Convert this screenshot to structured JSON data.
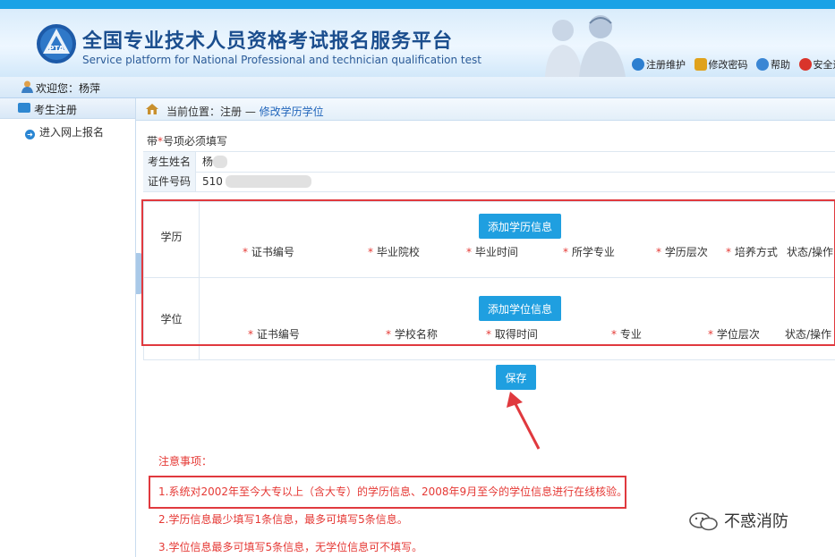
{
  "site": {
    "title_cn": "全国专业技术人员资格考试报名服务平台",
    "title_en": "Service platform for National Professional and technician qualification test",
    "logo_text": "PTA"
  },
  "toplinks": [
    {
      "label": "注册维护",
      "icon": "globe-icon"
    },
    {
      "label": "修改密码",
      "icon": "lock-icon"
    },
    {
      "label": "帮助",
      "icon": "help-icon"
    },
    {
      "label": "安全退",
      "icon": "power-icon"
    }
  ],
  "welcome": {
    "text": "欢迎您：杨萍"
  },
  "sidebar": {
    "header": "考生注册",
    "items": [
      {
        "label": "进入网上报名"
      }
    ]
  },
  "breadcrumb": {
    "prefix": "当前位置：注册 — ",
    "current": "修改学历学位"
  },
  "form": {
    "required_note_prefix": "带",
    "required_note_star": "*",
    "required_note_suffix": "号项必须填写",
    "name_label": "考生姓名",
    "name_value": "杨",
    "id_label": "证件号码",
    "id_value": "510"
  },
  "education": {
    "label": "学历",
    "add_button": "添加学历信息",
    "columns": [
      "证书编号",
      "毕业院校",
      "毕业时间",
      "所学专业",
      "学历层次",
      "培养方式",
      "状态/操作"
    ]
  },
  "degree": {
    "label": "学位",
    "add_button": "添加学位信息",
    "columns": [
      "证书编号",
      "学校名称",
      "取得时间",
      "专业",
      "学位层次",
      "状态/操作"
    ]
  },
  "save_button": "保存",
  "notes": {
    "title": "注意事项：",
    "items": [
      "1.系统对2002年至今大专以上（含大专）的学历信息、2008年9月至今的学位信息进行在线核验。",
      "2.学历信息最少填写1条信息，最多可填写5条信息。",
      "3.学位信息最多可填写5条信息，无学位信息可不填写。"
    ]
  },
  "watermark": "不惑消防",
  "colors": {
    "accent": "#1f9fe0",
    "warning": "#e53935",
    "title": "#1b4e8e",
    "highlight_box": "#e0393e"
  }
}
